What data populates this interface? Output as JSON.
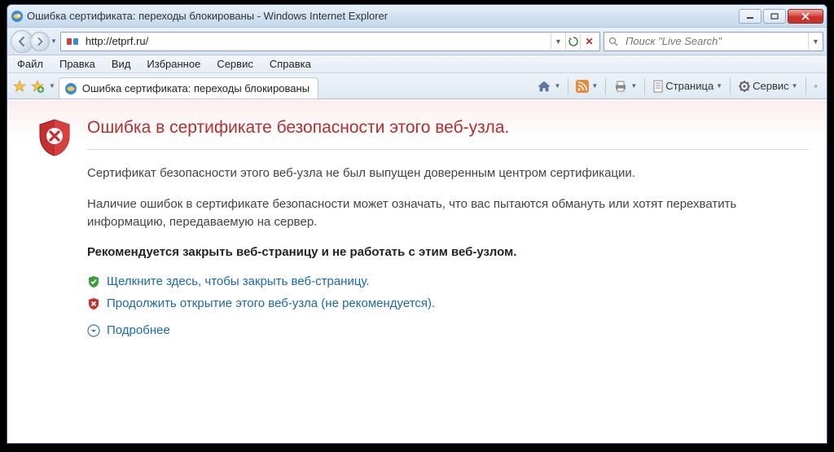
{
  "window": {
    "title": "Ошибка сертификата: переходы блокированы - Windows Internet Explorer"
  },
  "address": {
    "url": "http://etprf.ru/"
  },
  "search": {
    "placeholder": "Поиск \"Live Search\""
  },
  "menubar": {
    "items": [
      "Файл",
      "Правка",
      "Вид",
      "Избранное",
      "Сервис",
      "Справка"
    ]
  },
  "tab": {
    "title": "Ошибка сертификата: переходы блокированы"
  },
  "toolbar": {
    "page": "Страница",
    "tools": "Сервис"
  },
  "cert": {
    "heading": "Ошибка в сертификате безопасности этого веб-узла.",
    "para1": "Сертификат безопасности этого веб-узла не был выпущен доверенным центром сертификации.",
    "para2": "Наличие ошибок в сертификате безопасности может означать, что вас пытаются обмануть или хотят перехватить информацию, передаваемую на сервер.",
    "recommend": "Рекомендуется закрыть веб-страницу и не работать с этим веб-узлом.",
    "close_link": "Щелкните здесь, чтобы закрыть веб-страницу.",
    "continue_link": "Продолжить открытие этого веб-узла (не рекомендуется).",
    "more_link": "Подробнее"
  }
}
